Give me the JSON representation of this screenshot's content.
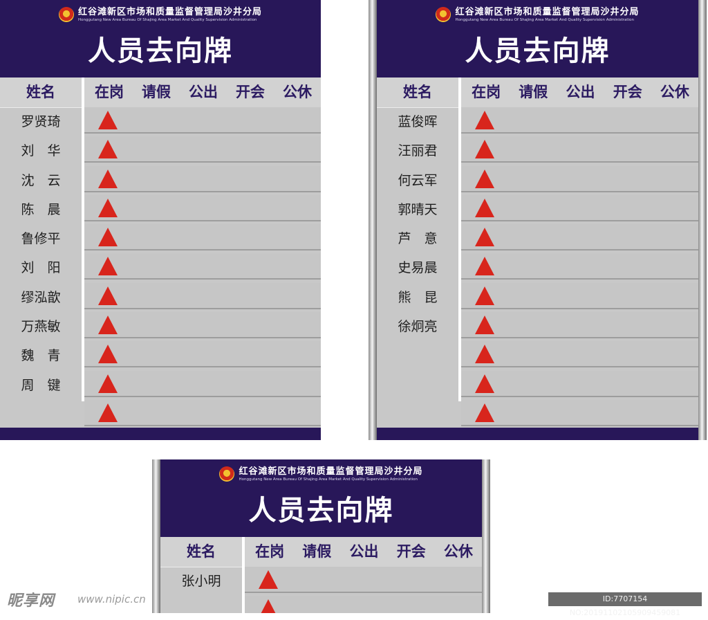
{
  "board_common": {
    "org_cn": "红谷滩新区市场和质量监督管理局沙井分局",
    "org_en": "Honggutang New Area Bureau Of Shajing Area Market And Quality Supervision Administration",
    "title": "人员去向牌",
    "name_header": "姓名",
    "status_headers": [
      "在岗",
      "请假",
      "公出",
      "开会",
      "公休"
    ]
  },
  "boards": [
    {
      "names": [
        "罗贤琦",
        "刘　华",
        "沈　云",
        "陈　晨",
        "鲁修平",
        "刘　阳",
        "缪泓歆",
        "万燕敏",
        "魏　青",
        "周　键",
        ""
      ]
    },
    {
      "names": [
        "蓝俊晖",
        "汪丽君",
        "何云军",
        "郭晴天",
        "芦　意",
        "史易晨",
        "熊　昆",
        "徐炯亮",
        "",
        "",
        ""
      ]
    },
    {
      "names": [
        "张小明",
        ""
      ]
    }
  ],
  "watermark": {
    "logo": "昵享网",
    "url": "www.nipic.cn",
    "id": "ID:7707154 NO:20191102105909459081"
  },
  "colors": {
    "header": "#281759",
    "marker": "#d8251c",
    "panel": "#c8c8c8"
  }
}
